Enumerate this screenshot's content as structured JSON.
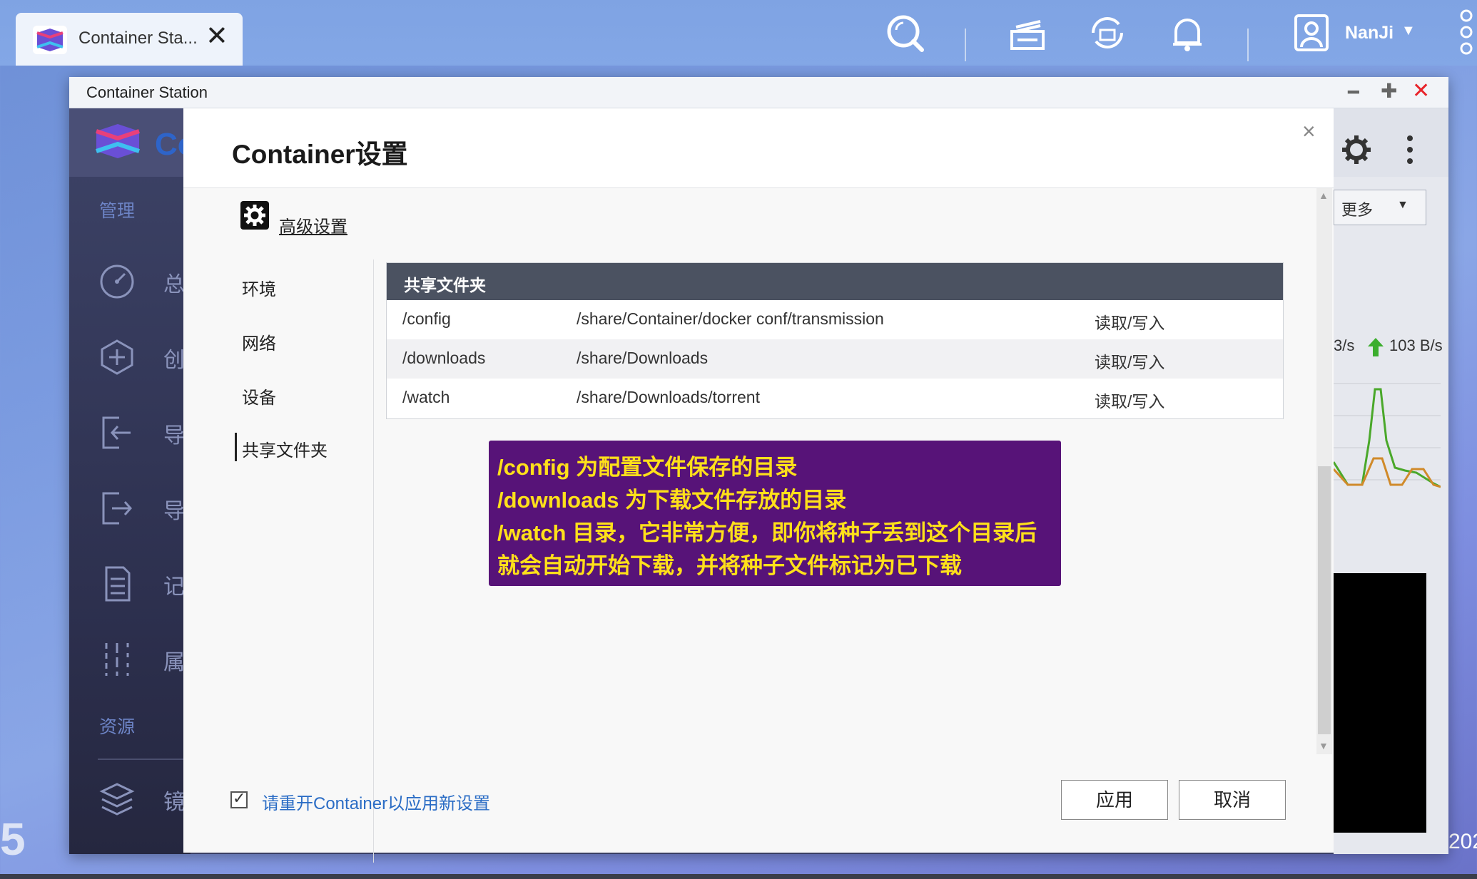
{
  "taskbar": {
    "tab_title": "Container Sta...",
    "tab_close": "✕",
    "user_name": "NanJi",
    "user_caret": "▼"
  },
  "window": {
    "title": "Container Station",
    "minimize": "━",
    "maximize": "✚",
    "close": "✕"
  },
  "background_app": {
    "app_name_fragment": "Co",
    "sidebar": {
      "section_manage": "管理",
      "section_resources": "资源",
      "items": [
        {
          "icon": "dashboard-icon",
          "text": "总"
        },
        {
          "icon": "create-icon",
          "text": "创"
        },
        {
          "icon": "import-icon",
          "text": "导"
        },
        {
          "icon": "export-icon",
          "text": "导"
        },
        {
          "icon": "log-icon",
          "text": "记"
        },
        {
          "icon": "properties-icon",
          "text": "属"
        },
        {
          "icon": "images-icon",
          "text": "镜"
        }
      ]
    },
    "more_button": "更多",
    "more_caret": "▼",
    "net_down_fragment": "3/s",
    "net_up": "103 B/s"
  },
  "dialog": {
    "title": "Container设置",
    "close": "×",
    "advanced_settings": "高级设置",
    "nav": [
      "环境",
      "网络",
      "设备",
      "共享文件夹"
    ],
    "active_nav": "共享文件夹",
    "table": {
      "header": "共享文件夹",
      "rows": [
        {
          "mount": "/config",
          "path": "/share/Container/docker conf/transmission",
          "mode": "读取/写入"
        },
        {
          "mount": "/downloads",
          "path": "/share/Downloads",
          "mode": "读取/写入"
        },
        {
          "mount": "/watch",
          "path": "/share/Downloads/torrent",
          "mode": "读取/写入"
        }
      ]
    },
    "annotation": [
      "/config 为配置文件保存的目录",
      "/downloads 为下载文件存放的目录",
      "/watch 目录，它非常方便，即你将种子丢到这个目录后",
      "就会自动开始下载，并将种子文件标记为已下载"
    ],
    "restart_checked": true,
    "restart_label": "请重开Container以应用新设置",
    "apply": "应用",
    "cancel": "取消"
  },
  "desktop": {
    "left_edge_glyph": "5",
    "right_edge_text": "202"
  },
  "colors": {
    "window_close_red": "#e8232a",
    "annotation_bg": "#571378",
    "annotation_text": "#ffe01a",
    "table_header_bg": "#4b5261",
    "link_blue": "#2a6cc5"
  }
}
